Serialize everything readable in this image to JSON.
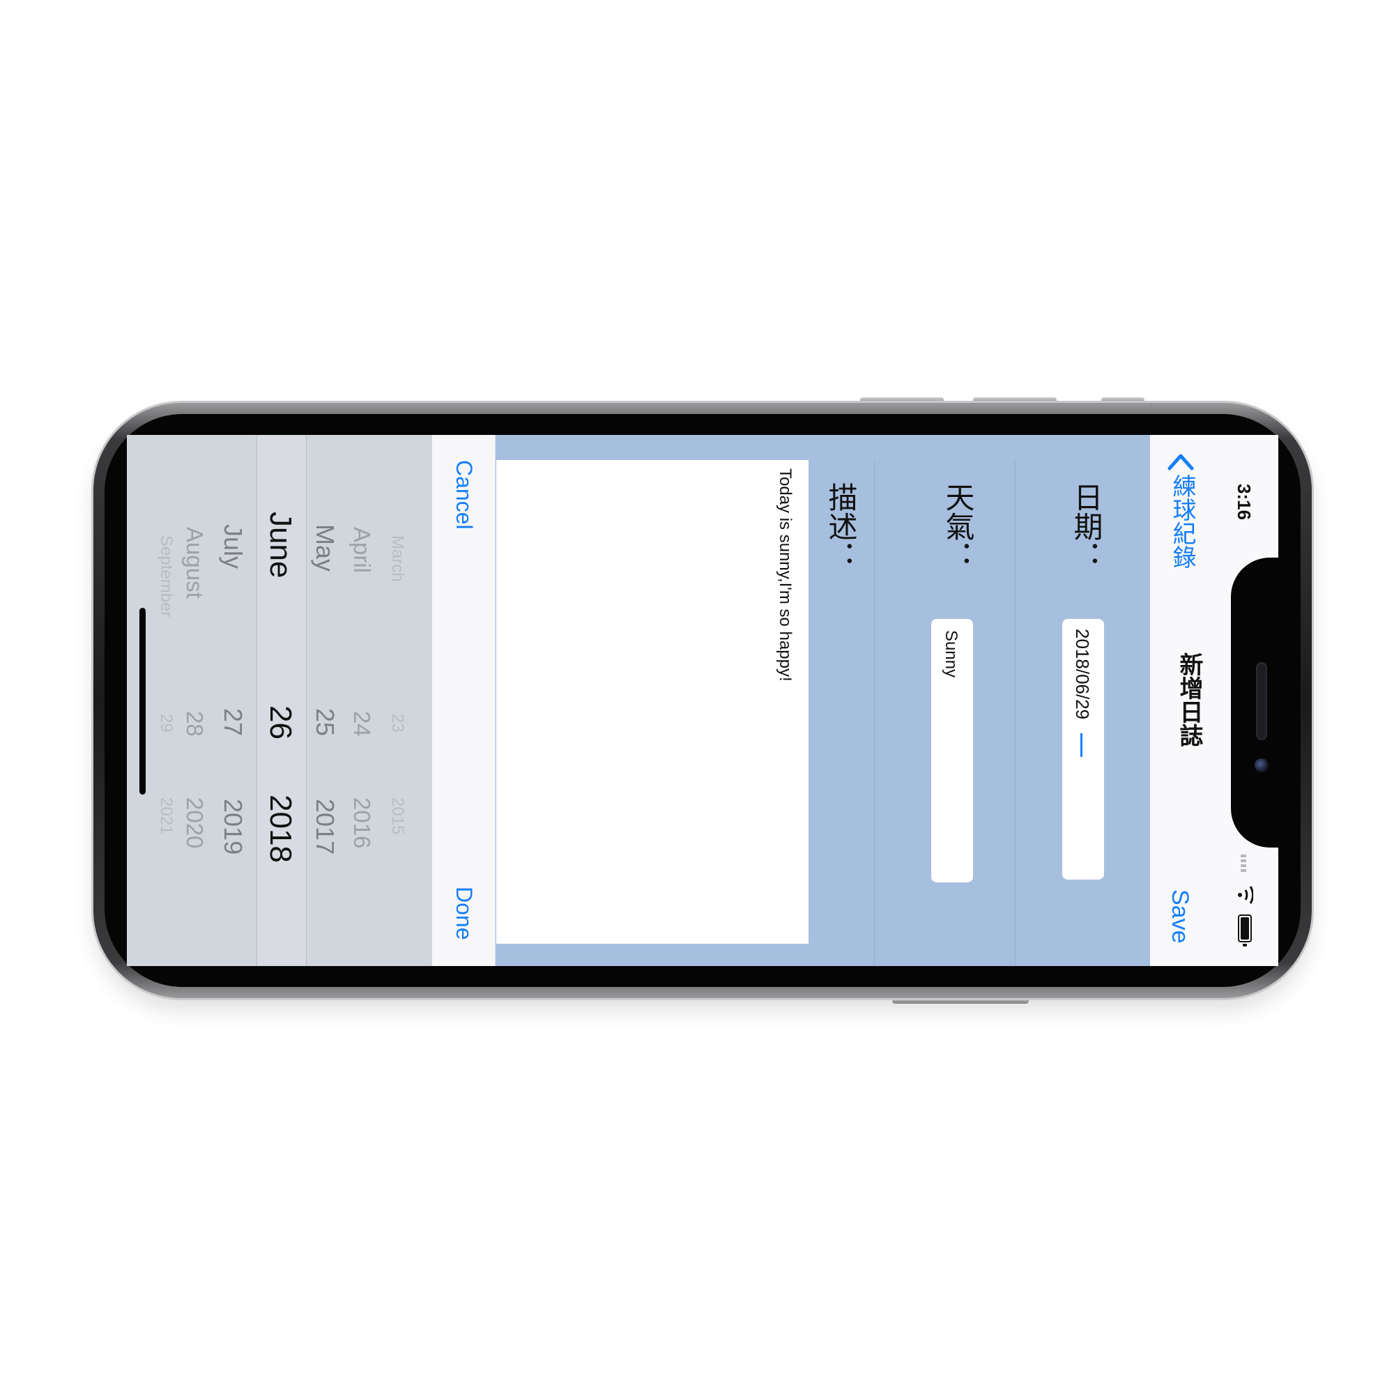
{
  "status_bar": {
    "time": "3:16"
  },
  "nav": {
    "back_label": "練球紀錄",
    "title": "新增日誌",
    "save_label": "Save"
  },
  "form": {
    "date_label": "日期：",
    "date_value": "2018/06/29",
    "weather_label": "天氣：",
    "weather_value": "Sunny",
    "description_label": "描述：",
    "description_value": "Today is sunny,I'm so happy!"
  },
  "picker_toolbar": {
    "cancel_label": "Cancel",
    "done_label": "Done"
  },
  "date_picker": {
    "months": [
      "March",
      "April",
      "May",
      "June",
      "July",
      "August",
      "September"
    ],
    "days": [
      "23",
      "24",
      "25",
      "26",
      "27",
      "28",
      "29"
    ],
    "years": [
      "2015",
      "2016",
      "2017",
      "2018",
      "2019",
      "2020",
      "2021"
    ],
    "selected": {
      "month": "June",
      "day": "26",
      "year": "2018"
    }
  },
  "colors": {
    "accent": "#147efb",
    "form_background": "#a7bfde",
    "picker_background": "#d1d6dd"
  }
}
